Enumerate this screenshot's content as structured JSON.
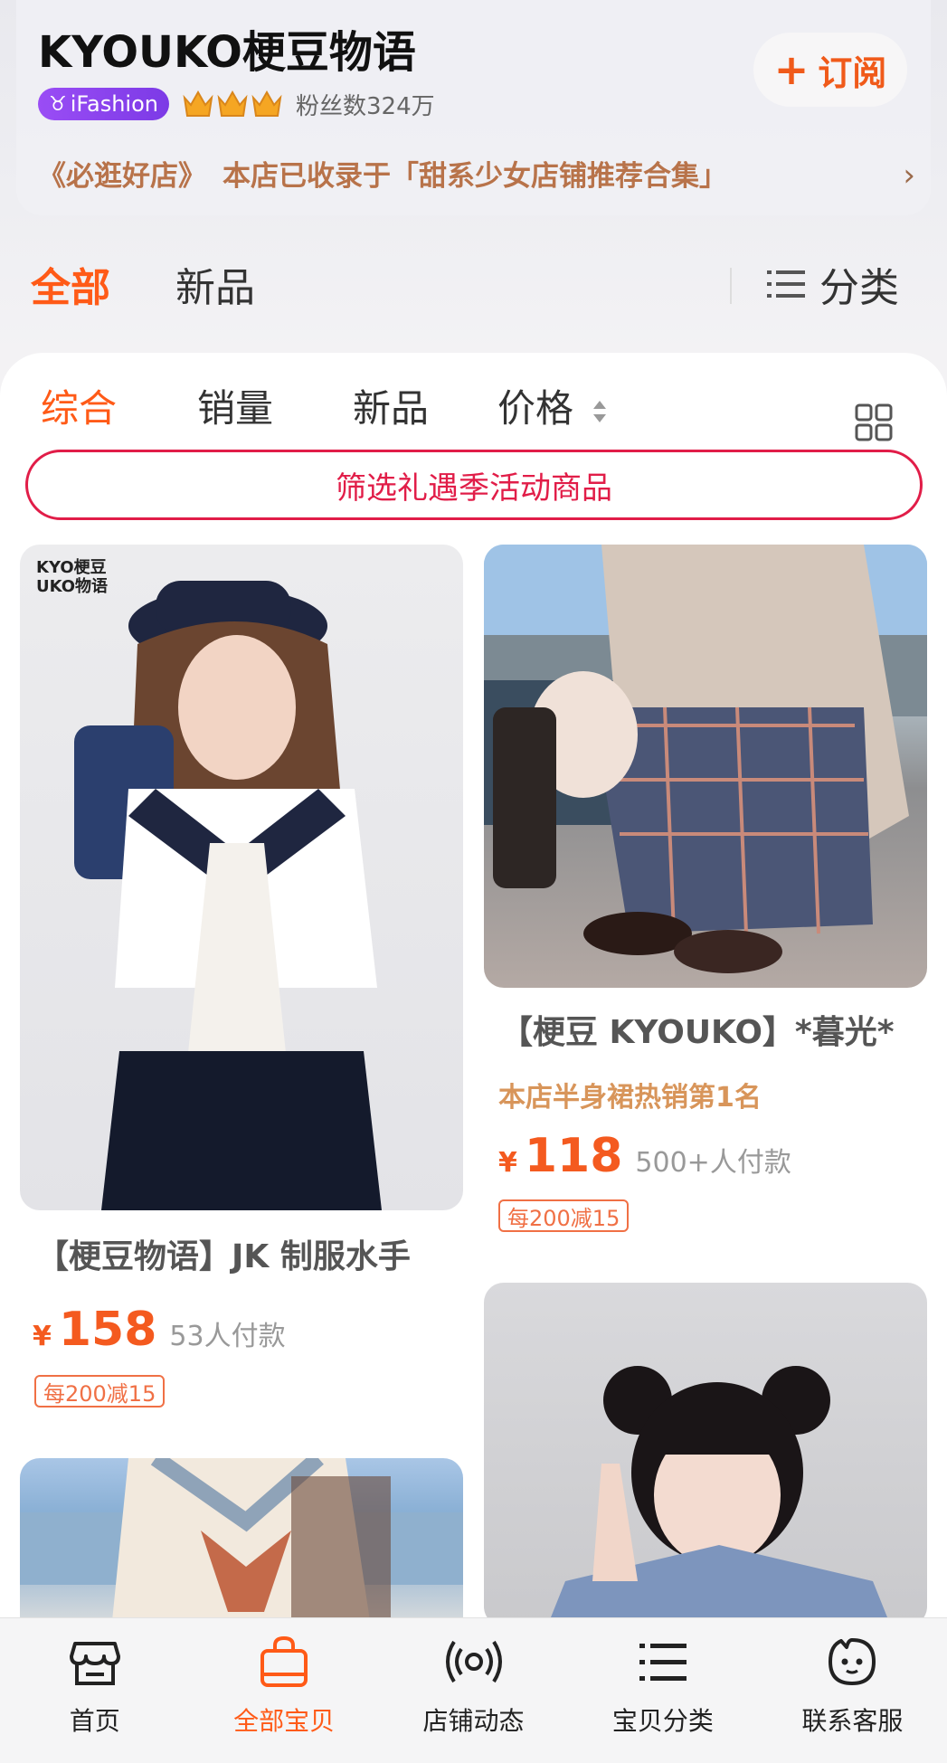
{
  "shop": {
    "name": "KYOUKO梗豆物语",
    "subscribe_label": "订阅",
    "badge_label": "iFashion",
    "fans_text": "粉丝数324万",
    "recommend_tag": "《必逛好店》",
    "recommend_text": "本店已收录于「甜系少女店铺推荐合集」"
  },
  "top_tabs": {
    "all": "全部",
    "new": "新品",
    "category": "分类"
  },
  "sort": {
    "items": [
      "综合",
      "销量",
      "新品",
      "价格"
    ],
    "active_index": 0
  },
  "filter_button": "筛选礼遇季活动商品",
  "products": [
    {
      "title": "【梗豆物语】JK 制服水手",
      "price": "158",
      "currency": "¥",
      "buyers": "53人付款",
      "coupon": "每200减15",
      "brand_logo": "KYO梗豆 UKO物语"
    },
    {
      "title": "【梗豆 KYOUKO】*暮光*",
      "rank": "本店半身裙热销第1名",
      "price": "118",
      "currency": "¥",
      "buyers": "500+人付款",
      "coupon": "每200减15"
    }
  ],
  "bottom_nav": [
    {
      "label": "首页",
      "icon": "store-icon"
    },
    {
      "label": "全部宝贝",
      "icon": "shopping-bag-icon",
      "active": true
    },
    {
      "label": "店铺动态",
      "icon": "broadcast-icon"
    },
    {
      "label": "宝贝分类",
      "icon": "list-icon"
    },
    {
      "label": "联系客服",
      "icon": "service-face-icon"
    }
  ],
  "colors": {
    "accent": "#ff5a17",
    "filter": "#e11d48",
    "recommend": "#b8734a"
  }
}
